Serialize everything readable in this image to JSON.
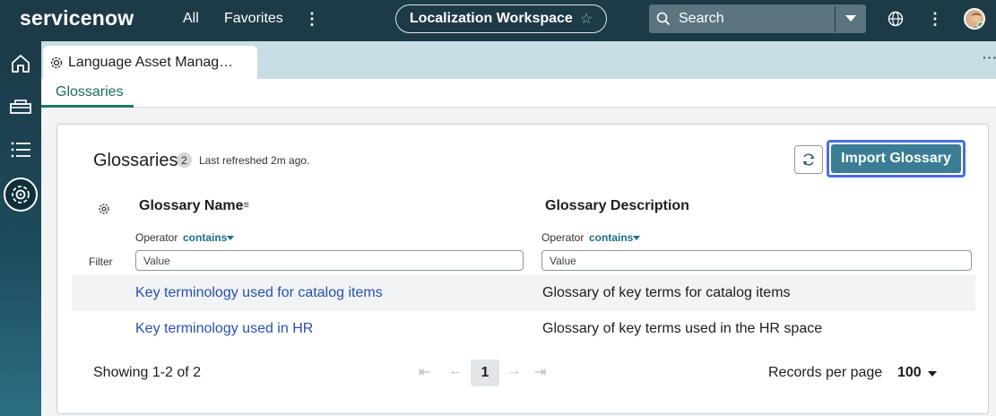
{
  "topnav": {
    "logo": "servicenow",
    "all_label": "All",
    "favorites_label": "Favorites",
    "more_label": "⋮",
    "workspace_title": "Localization Workspace",
    "search_placeholder": "Search",
    "more2_label": "⋮"
  },
  "rail": {
    "items": [
      "home-icon",
      "inbox-icon",
      "list-icon",
      "localization-icon"
    ]
  },
  "tabs": {
    "active_tab_label": "Language Asset Manag…",
    "overflow": "···"
  },
  "subtabs": {
    "active": "Glossaries"
  },
  "card": {
    "title": "Glossaries",
    "count": "2",
    "refreshed": "Last refreshed 2m ago.",
    "import_label": "Import Glossary"
  },
  "table": {
    "columns": [
      "Glossary Name",
      "Glossary Description"
    ],
    "operator_label": "Operator",
    "operator_value": "contains",
    "filter_label": "Filter",
    "filter_placeholder": "Value",
    "rows": [
      {
        "name": "Key terminology used for catalog items",
        "description": "Glossary of key terms for catalog items"
      },
      {
        "name": "Key terminology used in HR",
        "description": "Glossary of key terms used in the HR space"
      }
    ]
  },
  "pagination": {
    "showing": "Showing 1-2 of 2",
    "current_page": "1",
    "records_per_page_label": "Records per page",
    "records_per_page_value": "100"
  },
  "colors": {
    "nav_bg": "#1d3a47",
    "primary_button": "#3a7d95",
    "focus_ring": "#4a6ee0",
    "link": "#2a4fb0",
    "active_tab_accent": "#1a7b64"
  }
}
